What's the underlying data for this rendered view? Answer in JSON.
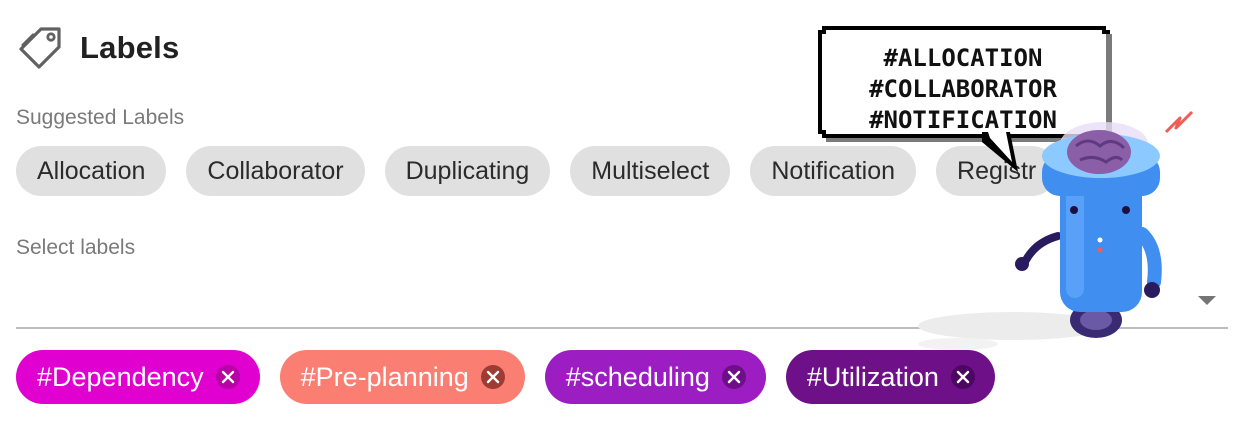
{
  "header": {
    "title": "Labels",
    "icon": "tag-icon"
  },
  "suggested": {
    "label": "Suggested Labels",
    "chips": [
      "Allocation",
      "Collaborator",
      "Duplicating",
      "Multiselect",
      "Notification",
      "Registr"
    ]
  },
  "select": {
    "label": "Select labels",
    "arrow_icon": "dropdown-arrow-icon"
  },
  "selected_labels": [
    {
      "text": "#Dependency",
      "color": "#e000cf",
      "close_bg": "#b700a6"
    },
    {
      "text": "#Pre-planning",
      "color": "#fa7f72",
      "close_bg": "#9e3b33"
    },
    {
      "text": "#scheduling",
      "color": "#9c1ec2",
      "close_bg": "#6e0f89"
    },
    {
      "text": "#Utilization",
      "color": "#6e1189",
      "close_bg": "#4d0762"
    }
  ],
  "mascot": {
    "bubble_lines": [
      "#ALLOCATION",
      "#COLLABORATOR",
      "#NOTIFICATION"
    ],
    "robot_color": "#3f8ef0",
    "brain_color": "#8a5fa8"
  }
}
